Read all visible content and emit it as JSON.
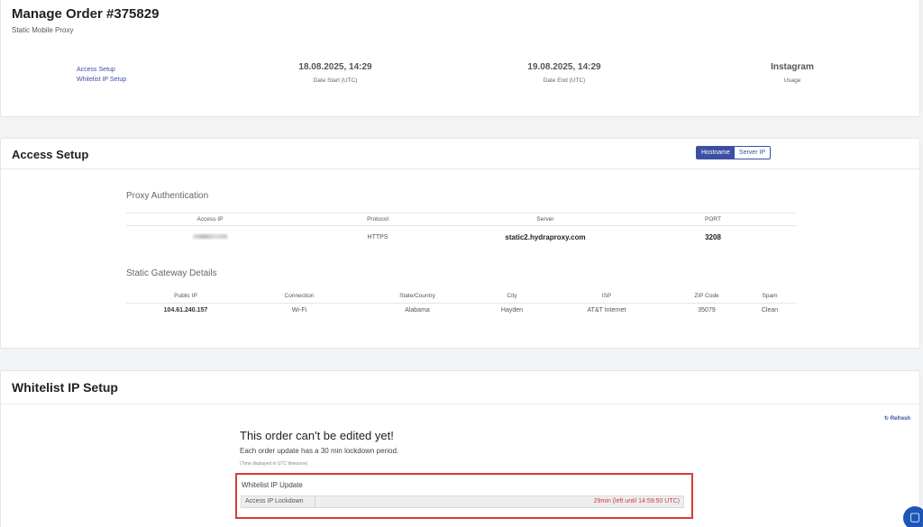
{
  "order": {
    "title": "Manage Order #375829",
    "subtitle": "Static Mobile Proxy"
  },
  "links": {
    "access_setup": "Access Setup",
    "whitelist_setup": "Whitelist IP Setup"
  },
  "stats": [
    {
      "value": "18.08.2025, 14:29",
      "label": "Date Start (UTC)"
    },
    {
      "value": "19.08.2025, 14:29",
      "label": "Date End (UTC)"
    },
    {
      "value": "Instagram",
      "label": "Usage"
    }
  ],
  "access": {
    "title": "Access Setup",
    "toggle": {
      "hostname": "Hostname",
      "server_ip": "Server IP",
      "selected": "Hostname"
    },
    "auth_title": "Proxy Authentication",
    "auth_headers": [
      "Access IP",
      "Protocol",
      "Server",
      "PORT"
    ],
    "auth_row": {
      "access_ip": "",
      "protocol": "HTTPS",
      "server": "static2.hydraproxy.com",
      "port": "3208"
    },
    "gateway_title": "Static Gateway Details",
    "gateway_headers": [
      "Public IP",
      "Connection",
      "State/Country",
      "City",
      "ISP",
      "ZIP Code",
      "Spam"
    ],
    "gateway_row": [
      "104.61.240.157",
      "Wi-Fi",
      "Alabama",
      "Hayden",
      "AT&T Internet",
      "35079",
      "Clean"
    ]
  },
  "whitelist": {
    "title": "Whitelist IP Setup",
    "refresh": "Refresh",
    "warning_title": "This order can't be edited yet!",
    "warning_sub": "Each order update has a 30 min lockdown period.",
    "tz_note": "(Time displayed in UTC timezone)",
    "update_title": "Whitelist IP Update",
    "lockdown_label": "Access IP Lockdown",
    "lockdown_value": "29min (left until 14:59:50 UTC)"
  },
  "colors": {
    "accent": "#3b4ea2",
    "alert": "#d9393b",
    "chat": "#1e56b8"
  },
  "icons": {
    "refresh": "refresh-icon",
    "chat": "chat-icon"
  }
}
